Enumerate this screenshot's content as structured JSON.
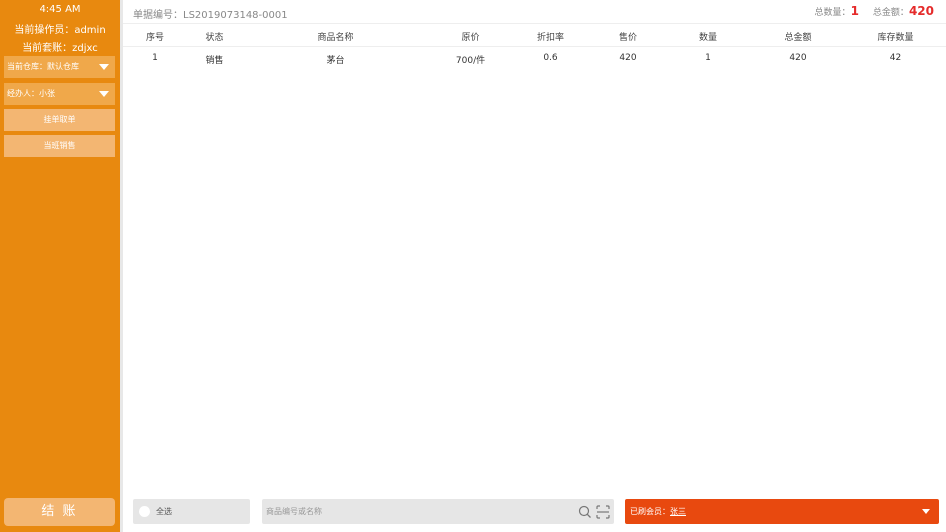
{
  "sidebar": {
    "time": "4:45 AM",
    "operator": "当前操作员：admin",
    "account": "当前套账：zdjxc",
    "warehouse_select": "当前仓库：默认仓库",
    "handler_select": "经办人：小张",
    "hold_button": "挂单取单",
    "shift_sales_button": "当班销售",
    "checkout_button": "结 账"
  },
  "header": {
    "order_no": "单据编号：LS2019073148-0001",
    "total_qty_label": "总数量：",
    "total_qty": "1",
    "total_amount_label": "总金额：",
    "total_amount": "420"
  },
  "table": {
    "columns": [
      "序号",
      "状态",
      "商品名称",
      "原价",
      "折扣率",
      "售价",
      "数量",
      "总金额",
      "库存数量"
    ],
    "rows": [
      [
        "1",
        "销售",
        "茅台",
        "700/件",
        "0.6",
        "420",
        "1",
        "420",
        "42"
      ]
    ]
  },
  "bottom": {
    "select_all": "全选",
    "search_placeholder": "商品编号或名称",
    "member_label": "已刷会员：",
    "member_name": "张三"
  },
  "icons": {
    "search": "search-icon",
    "scan": "scan-icon",
    "dropdown": "chevron-down-icon"
  },
  "colors": {
    "sidebar": "#e8890f",
    "accent_red": "#e52b2b",
    "member_bar": "#e8490f"
  }
}
